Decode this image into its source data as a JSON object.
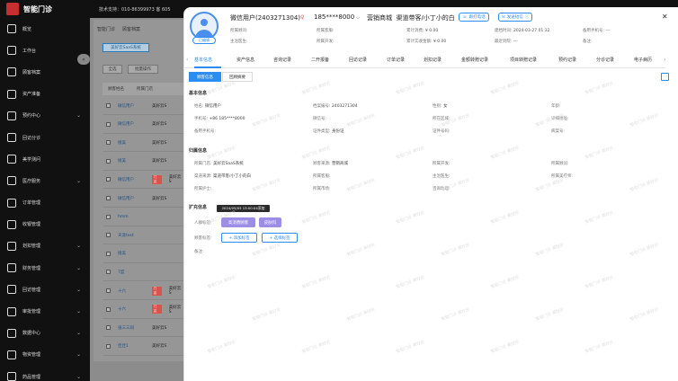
{
  "app": {
    "name": "智能门诊"
  },
  "topbar": {
    "support": "技术支持：010-86399973 客 605"
  },
  "sidebar": {
    "items": [
      {
        "label": "概览",
        "chevron": false
      },
      {
        "label": "工作台",
        "chevron": false
      },
      {
        "label": "顾客档案",
        "chevron": false
      },
      {
        "label": "资产准备",
        "chevron": false
      },
      {
        "label": "预约中心",
        "chevron": true
      },
      {
        "label": "回访分诊",
        "chevron": false
      },
      {
        "label": "美学测问",
        "chevron": false
      },
      {
        "label": "医疗服务",
        "chevron": true
      },
      {
        "label": "订单管理",
        "chevron": false
      },
      {
        "label": "收银管理",
        "chevron": false
      },
      {
        "label": "划扣管理",
        "chevron": true
      },
      {
        "label": "财务管理",
        "chevron": true
      },
      {
        "label": "回访管理",
        "chevron": true
      },
      {
        "label": "审批管理",
        "chevron": true
      },
      {
        "label": "数据中心",
        "chevron": true
      },
      {
        "label": "物资管理",
        "chevron": true
      },
      {
        "label": "药品管理",
        "chevron": true
      }
    ]
  },
  "background": {
    "tabs": [
      "智能门诊",
      "顾客档案"
    ],
    "filter_tag": "美好云SaaS系统",
    "buttons": [
      "全选",
      "批量操作"
    ],
    "table_headers": [
      "顾客姓名",
      "所属门店"
    ],
    "rows": [
      {
        "name": "微信用户",
        "tag": "",
        "src": "美好云S"
      },
      {
        "name": "微信用户",
        "tag": "",
        "src": "美好云S"
      },
      {
        "name": "接美",
        "tag": "",
        "src": "美好云S"
      },
      {
        "name": "接美",
        "tag": "",
        "src": "美好云S"
      },
      {
        "name": "微信用户",
        "tag": "门店",
        "src": "美好云S"
      },
      {
        "name": "微信用户",
        "tag": "",
        "src": "美好云S"
      },
      {
        "name": "hmm",
        "tag": "",
        "src": ""
      },
      {
        "name": "天涯test",
        "tag": "",
        "src": ""
      },
      {
        "name": "接美",
        "tag": "",
        "src": ""
      },
      {
        "name": "7度",
        "tag": "",
        "src": ""
      },
      {
        "name": "十六",
        "tag": "门店",
        "src": "美好云S"
      },
      {
        "name": "十六",
        "tag": "门店",
        "src": "美好云S"
      },
      {
        "name": "张三三同",
        "tag": "",
        "src": "美好云S"
      },
      {
        "name": "佳佳1",
        "tag": "",
        "src": "美好云S"
      }
    ]
  },
  "drawer": {
    "header": {
      "name": "微信用户(2403271304)",
      "phone": "185****8000",
      "source": "营销商城",
      "channel": "渠道带客/小丁小的白",
      "edit_label": "已编辑",
      "btn_followup": "跟打电话",
      "btn_sms": "发送短信"
    },
    "info": [
      {
        "label": "所属顾问:",
        "value": ""
      },
      {
        "label": "所属客服:",
        "value": ""
      },
      {
        "label": "累计消费:",
        "value": "¥ 0.00"
      },
      {
        "label": "建档时间:",
        "value": "2024-03-27 01:32"
      },
      {
        "label": "备用手机号:",
        "value": "---"
      },
      {
        "label": "主治医生:",
        "value": ""
      },
      {
        "label": "所属开发:",
        "value": ""
      },
      {
        "label": "累计实收金额:",
        "value": "¥ 0.00"
      },
      {
        "label": "最近到院:",
        "value": "---"
      },
      {
        "label": "备注:",
        "value": ""
      }
    ],
    "tabs": [
      "基本信息",
      "资产信息",
      "咨询记录",
      "二开报备",
      "回访记录",
      "订单记录",
      "划扣记录",
      "金额转赠记录",
      "项目转赠记录",
      "预约记录",
      "分诊记录",
      "电子病历"
    ],
    "subtabs": [
      "顾客信息",
      "回顾摘要"
    ],
    "basic": {
      "title": "基本信息",
      "fields": [
        {
          "label": "姓名:",
          "value": "微信用户"
        },
        {
          "label": "档案编号:",
          "value": "2403271304"
        },
        {
          "label": "性别:",
          "value": "女"
        },
        {
          "label": "年龄:",
          "value": ""
        },
        {
          "label": "手机号:",
          "value": "+86  185****8000"
        },
        {
          "label": "微信号:",
          "value": ""
        },
        {
          "label": "所在区域:",
          "value": ""
        },
        {
          "label": "详细地址:",
          "value": ""
        },
        {
          "label": "备用手机号:",
          "value": ""
        },
        {
          "label": "证件类型:",
          "value": "身份证"
        },
        {
          "label": "证件号码:",
          "value": ""
        },
        {
          "label": "病案号:",
          "value": ""
        }
      ]
    },
    "belong": {
      "title": "归属信息",
      "fields": [
        {
          "label": "所属门店:",
          "value": "美好云SaaS系统"
        },
        {
          "label": "顾客来源:",
          "value": "营销商城"
        },
        {
          "label": "所属开发:",
          "value": ""
        },
        {
          "label": "所属顾问:",
          "value": ""
        },
        {
          "label": "渠道来源:",
          "value": "渠道带客/小丁小的白"
        },
        {
          "label": "所属客服:",
          "value": ""
        },
        {
          "label": "主治医生:",
          "value": ""
        },
        {
          "label": "所属美疗师:",
          "value": ""
        },
        {
          "label": "所属护士:",
          "value": ""
        },
        {
          "label": "所属市场:",
          "value": ""
        },
        {
          "label": "咨询助理:",
          "value": ""
        }
      ]
    },
    "ext": {
      "title": "扩充信息",
      "tooltip": "2024/05/05 13:00:04添加",
      "crowd_label": "人群标签:",
      "crowd_tags": [
        "高消费顾客",
        "皮肤科"
      ],
      "customer_label": "顾客标签:",
      "add_tag": "+ 添加标签",
      "select_tag": "+ 选择标签",
      "remark_label": "备注:"
    },
    "watermark": "智能门诊 美好云"
  },
  "colors": {
    "accent": "#2d8cf0",
    "purple_tag": "#9b8ee6",
    "sidebar_bg": "#111111",
    "danger": "#e84a4a"
  }
}
